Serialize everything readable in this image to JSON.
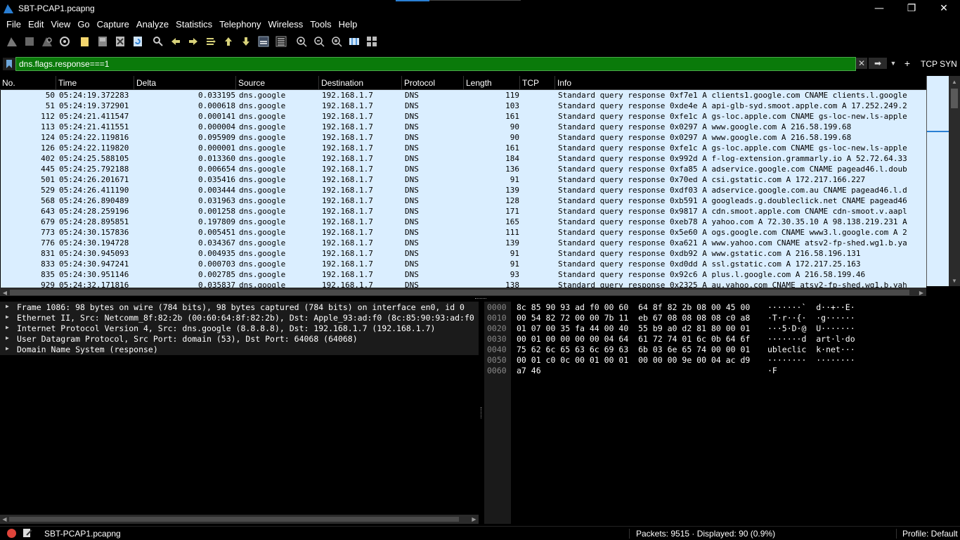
{
  "window": {
    "title": "SBT-PCAP1.pcapng",
    "controls": {
      "minimize": "—",
      "restore": "❐",
      "close": "✕"
    }
  },
  "menu": [
    "File",
    "Edit",
    "View",
    "Go",
    "Capture",
    "Analyze",
    "Statistics",
    "Telephony",
    "Wireless",
    "Tools",
    "Help"
  ],
  "toolbar_icons": [
    "shark-fin-start-icon",
    "stop-capture-icon",
    "restart-capture-icon",
    "capture-options-icon",
    "open-file-icon",
    "save-file-icon",
    "close-file-icon",
    "reload-file-icon",
    "find-packet-icon",
    "go-back-icon",
    "go-forward-icon",
    "go-to-packet-icon",
    "go-first-icon",
    "go-last-icon",
    "autoscroll-icon",
    "colorize-icon",
    "zoom-in-icon",
    "zoom-out-icon",
    "zoom-normal-icon",
    "resize-columns-icon",
    "layout-icon"
  ],
  "filter": {
    "value": "dns.flags.response===1",
    "color": "#0a7a0a",
    "button_label": "TCP SYN"
  },
  "packet_list": {
    "columns": [
      "No.",
      "Time",
      "Delta",
      "Source",
      "Destination",
      "Protocol",
      "Length",
      "TCP Seg",
      "Info"
    ],
    "row_bg": "#daeeff",
    "rows": [
      {
        "no": "50",
        "time": "05:24:19.372283",
        "delta": "0.033195",
        "src": "dns.google",
        "dst": "192.168.1.7",
        "proto": "DNS",
        "len": "119",
        "info": "Standard query response 0xf7e1 A clients1.google.com CNAME clients.l.google"
      },
      {
        "no": "51",
        "time": "05:24:19.372901",
        "delta": "0.000618",
        "src": "dns.google",
        "dst": "192.168.1.7",
        "proto": "DNS",
        "len": "103",
        "info": "Standard query response 0xde4e A api-glb-syd.smoot.apple.com A 17.252.249.2"
      },
      {
        "no": "112",
        "time": "05:24:21.411547",
        "delta": "0.000141",
        "src": "dns.google",
        "dst": "192.168.1.7",
        "proto": "DNS",
        "len": "161",
        "info": "Standard query response 0xfe1c A gs-loc.apple.com CNAME gs-loc-new.ls-apple"
      },
      {
        "no": "113",
        "time": "05:24:21.411551",
        "delta": "0.000004",
        "src": "dns.google",
        "dst": "192.168.1.7",
        "proto": "DNS",
        "len": "90",
        "info": "Standard query response 0x0297 A www.google.com A 216.58.199.68"
      },
      {
        "no": "124",
        "time": "05:24:22.119816",
        "delta": "0.095909",
        "src": "dns.google",
        "dst": "192.168.1.7",
        "proto": "DNS",
        "len": "90",
        "info": "Standard query response 0x0297 A www.google.com A 216.58.199.68"
      },
      {
        "no": "126",
        "time": "05:24:22.119820",
        "delta": "0.000001",
        "src": "dns.google",
        "dst": "192.168.1.7",
        "proto": "DNS",
        "len": "161",
        "info": "Standard query response 0xfe1c A gs-loc.apple.com CNAME gs-loc-new.ls-apple"
      },
      {
        "no": "402",
        "time": "05:24:25.588105",
        "delta": "0.013360",
        "src": "dns.google",
        "dst": "192.168.1.7",
        "proto": "DNS",
        "len": "184",
        "info": "Standard query response 0x992d A f-log-extension.grammarly.io A 52.72.64.33"
      },
      {
        "no": "445",
        "time": "05:24:25.792188",
        "delta": "0.006654",
        "src": "dns.google",
        "dst": "192.168.1.7",
        "proto": "DNS",
        "len": "136",
        "info": "Standard query response 0xfa85 A adservice.google.com CNAME pagead46.l.doub"
      },
      {
        "no": "501",
        "time": "05:24:26.201671",
        "delta": "0.035416",
        "src": "dns.google",
        "dst": "192.168.1.7",
        "proto": "DNS",
        "len": "91",
        "info": "Standard query response 0x70ed A csi.gstatic.com A 172.217.166.227"
      },
      {
        "no": "529",
        "time": "05:24:26.411190",
        "delta": "0.003444",
        "src": "dns.google",
        "dst": "192.168.1.7",
        "proto": "DNS",
        "len": "139",
        "info": "Standard query response 0xdf03 A adservice.google.com.au CNAME pagead46.l.d"
      },
      {
        "no": "568",
        "time": "05:24:26.890489",
        "delta": "0.031963",
        "src": "dns.google",
        "dst": "192.168.1.7",
        "proto": "DNS",
        "len": "128",
        "info": "Standard query response 0xb591 A googleads.g.doubleclick.net CNAME pagead46"
      },
      {
        "no": "643",
        "time": "05:24:28.259196",
        "delta": "0.001258",
        "src": "dns.google",
        "dst": "192.168.1.7",
        "proto": "DNS",
        "len": "171",
        "info": "Standard query response 0x9817 A cdn.smoot.apple.com CNAME cdn-smoot.v.aapl"
      },
      {
        "no": "679",
        "time": "05:24:28.895851",
        "delta": "0.197809",
        "src": "dns.google",
        "dst": "192.168.1.7",
        "proto": "DNS",
        "len": "165",
        "info": "Standard query response 0xeb78 A yahoo.com A 72.30.35.10 A 98.138.219.231 A"
      },
      {
        "no": "773",
        "time": "05:24:30.157836",
        "delta": "0.005451",
        "src": "dns.google",
        "dst": "192.168.1.7",
        "proto": "DNS",
        "len": "111",
        "info": "Standard query response 0x5e60 A ogs.google.com CNAME www3.l.google.com A 2"
      },
      {
        "no": "776",
        "time": "05:24:30.194728",
        "delta": "0.034367",
        "src": "dns.google",
        "dst": "192.168.1.7",
        "proto": "DNS",
        "len": "139",
        "info": "Standard query response 0xa621 A www.yahoo.com CNAME atsv2-fp-shed.wg1.b.ya"
      },
      {
        "no": "831",
        "time": "05:24:30.945093",
        "delta": "0.004935",
        "src": "dns.google",
        "dst": "192.168.1.7",
        "proto": "DNS",
        "len": "91",
        "info": "Standard query response 0xdb92 A www.gstatic.com A 216.58.196.131"
      },
      {
        "no": "833",
        "time": "05:24:30.947241",
        "delta": "0.000703",
        "src": "dns.google",
        "dst": "192.168.1.7",
        "proto": "DNS",
        "len": "91",
        "info": "Standard query response 0xd0dd A ssl.gstatic.com A 172.217.25.163"
      },
      {
        "no": "835",
        "time": "05:24:30.951146",
        "delta": "0.002785",
        "src": "dns.google",
        "dst": "192.168.1.7",
        "proto": "DNS",
        "len": "93",
        "info": "Standard query response 0x92c6 A plus.l.google.com A 216.58.199.46"
      },
      {
        "no": "929",
        "time": "05:24:32.171816",
        "delta": "0.035837",
        "src": "dns.google",
        "dst": "192.168.1.7",
        "proto": "DNS",
        "len": "138",
        "info": "Standard query response 0x2325 A au.yahoo.com CNAME atsv2-fp-shed.wg1.b.yah"
      }
    ]
  },
  "details": [
    "Frame 1086: 98 bytes on wire (784 bits), 98 bytes captured (784 bits) on interface en0, id 0",
    "Ethernet II, Src: Netcomm_8f:82:2b (00:60:64:8f:82:2b), Dst: Apple_93:ad:f0 (8c:85:90:93:ad:f0",
    "Internet Protocol Version 4, Src: dns.google (8.8.8.8), Dst: 192.168.1.7 (192.168.1.7)",
    "User Datagram Protocol, Src Port: domain (53), Dst Port: 64068 (64068)",
    "Domain Name System (response)"
  ],
  "bytes": [
    {
      "off": "0000",
      "hex": "8c 85 90 93 ad f0 00 60  64 8f 82 2b 08 00 45 00",
      "ascii": "·······`  d··+··E·"
    },
    {
      "off": "0010",
      "hex": "00 54 82 72 00 00 7b 11  eb 67 08 08 08 08 c0 a8",
      "ascii": "·T·r··{·  ·g······"
    },
    {
      "off": "0020",
      "hex": "01 07 00 35 fa 44 00 40  55 b9 a0 d2 81 80 00 01",
      "ascii": "···5·D·@  U·······"
    },
    {
      "off": "0030",
      "hex": "00 01 00 00 00 00 04 64  61 72 74 01 6c 0b 64 6f",
      "ascii": "·······d  art·l·do"
    },
    {
      "off": "0040",
      "hex": "75 62 6c 65 63 6c 69 63  6b 03 6e 65 74 00 00 01",
      "ascii": "ubleclic  k·net···"
    },
    {
      "off": "0050",
      "hex": "00 01 c0 0c 00 01 00 01  00 00 00 9e 00 04 ac d9",
      "ascii": "········  ········"
    },
    {
      "off": "0060",
      "hex": "a7 46",
      "ascii": "·F"
    }
  ],
  "status": {
    "file": "SBT-PCAP1.pcapng",
    "packets": "Packets: 9515 · Displayed: 90 (0.9%)",
    "profile": "Profile: Default"
  }
}
